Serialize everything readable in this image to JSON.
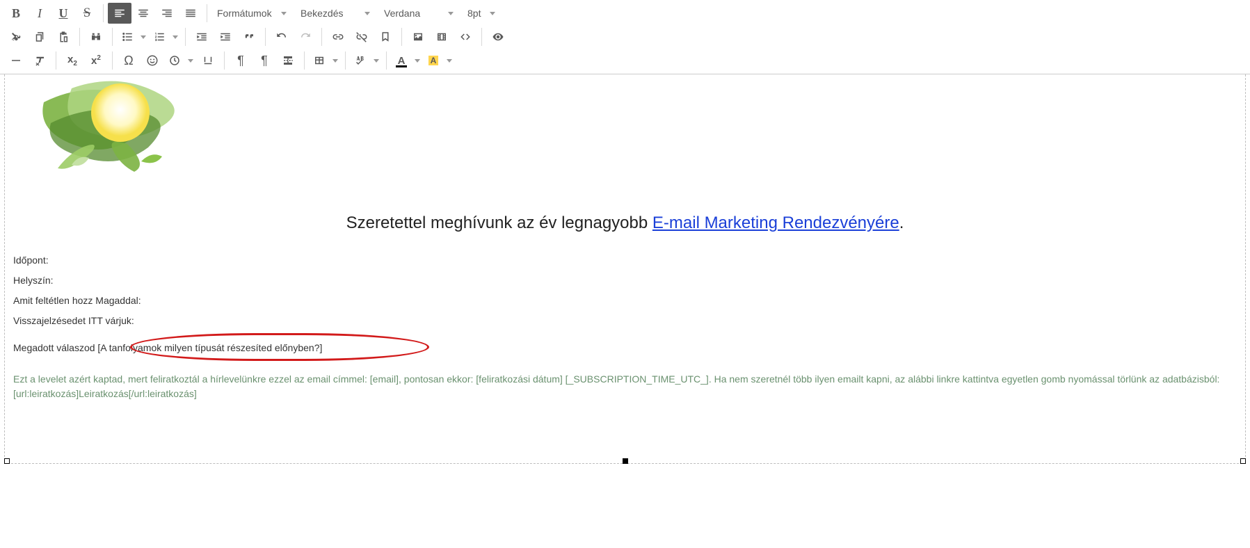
{
  "toolbar": {
    "dropdowns": {
      "formats": "Formátumok",
      "paragraph": "Bekezdés",
      "font": "Verdana",
      "size": "8pt"
    },
    "icons": {
      "bold": "B",
      "italic": "I",
      "underline": "U",
      "strike": "S",
      "sub": "x",
      "sup": "x",
      "omega": "Ω",
      "txtcolor": "A",
      "bgcolor": "A",
      "pilcrow": "¶",
      "pilcrow2": "¶"
    }
  },
  "content": {
    "invite_prefix": "Szeretettel meghívunk az év legnagyobb ",
    "invite_link": "E-mail Marketing Rendezvényére",
    "invite_suffix": ".",
    "time_label": "Időpont:",
    "place_label": "Helyszín:",
    "bring_label": "Amit feltétlen hozz Magaddal:",
    "feedback_label": "Visszajelzésedet ITT várjuk:",
    "answer_label": "Megadott válaszod",
    "answer_token": "[A tanfolyamok milyen típusát részesíted előnyben?]",
    "footer": "Ezt a levelet azért kaptad, mert feliratkoztál a hírlevelünkre ezzel az email címmel: [email], pontosan ekkor: [feliratkozási dátum] [_SUBSCRIPTION_TIME_UTC_]. Ha nem szeretnél több ilyen emailt kapni, az alábbi linkre kattintva egyetlen gomb nyomással törlünk az adatbázisból: [url:leiratkozás]Leiratkozás[/url:leiratkozás]"
  }
}
